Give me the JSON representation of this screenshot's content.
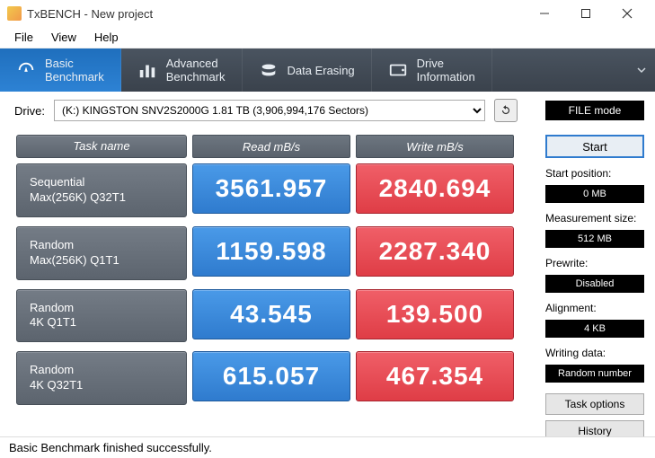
{
  "window": {
    "title": "TxBENCH - New project"
  },
  "menu": {
    "file": "File",
    "view": "View",
    "help": "Help"
  },
  "tabs": {
    "basic": "Basic\nBenchmark",
    "advanced": "Advanced\nBenchmark",
    "erasing": "Data Erasing",
    "driveinfo": "Drive\nInformation"
  },
  "toolbar": {
    "drive_label": "Drive:",
    "drive_value": "(K:) KINGSTON SNV2S2000G  1.81 TB (3,906,994,176 Sectors)",
    "mode_btn": "FILE mode"
  },
  "headers": {
    "task": "Task name",
    "read": "Read mB/s",
    "write": "Write mB/s"
  },
  "rows": [
    {
      "name1": "Sequential",
      "name2": "Max(256K) Q32T1",
      "read": "3561.957",
      "write": "2840.694"
    },
    {
      "name1": "Random",
      "name2": "Max(256K) Q1T1",
      "read": "1159.598",
      "write": "2287.340"
    },
    {
      "name1": "Random",
      "name2": "4K Q1T1",
      "read": "43.545",
      "write": "139.500"
    },
    {
      "name1": "Random",
      "name2": "4K Q32T1",
      "read": "615.057",
      "write": "467.354"
    }
  ],
  "side": {
    "start": "Start",
    "start_pos_label": "Start position:",
    "start_pos_value": "0 MB",
    "meas_label": "Measurement size:",
    "meas_value": "512 MB",
    "prewrite_label": "Prewrite:",
    "prewrite_value": "Disabled",
    "align_label": "Alignment:",
    "align_value": "4 KB",
    "writing_label": "Writing data:",
    "writing_value": "Random number",
    "task_options": "Task options",
    "history": "History"
  },
  "status": "Basic Benchmark finished successfully."
}
